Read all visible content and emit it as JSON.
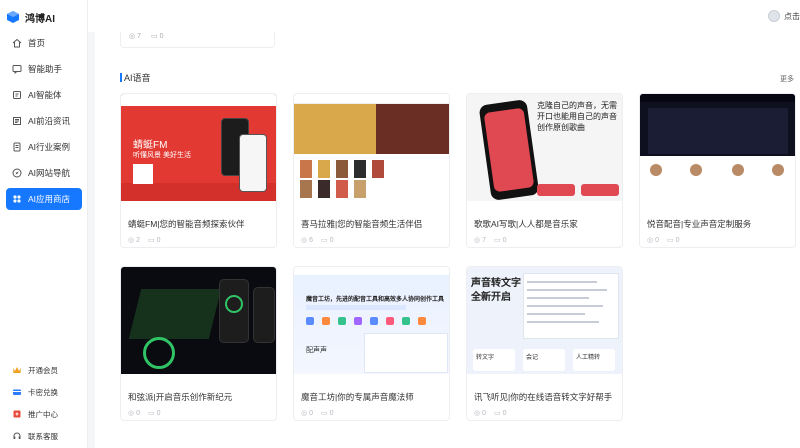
{
  "app": {
    "name": "鸿博AI"
  },
  "sidebar": {
    "items": [
      {
        "label": "首页",
        "icon": "home-icon"
      },
      {
        "label": "智能助手",
        "icon": "chat-icon"
      },
      {
        "label": "AI智能体",
        "icon": "agent-icon"
      },
      {
        "label": "AI前沿资讯",
        "icon": "news-icon"
      },
      {
        "label": "AI行业案例",
        "icon": "case-icon"
      },
      {
        "label": "AI网站导航",
        "icon": "compass-icon"
      },
      {
        "label": "AI应用商店",
        "icon": "apps-icon",
        "active": true
      }
    ],
    "bottom": [
      {
        "label": "开通会员",
        "icon": "vip-icon"
      },
      {
        "label": "卡密兑换",
        "icon": "card-icon"
      },
      {
        "label": "推广中心",
        "icon": "promo-icon"
      },
      {
        "label": "联系客服",
        "icon": "service-icon"
      }
    ]
  },
  "topbar": {
    "user_label": "点击"
  },
  "prev_card": {
    "views": "7",
    "comments": "0"
  },
  "section": {
    "title": "AI语音",
    "more": "更多"
  },
  "cards": [
    {
      "title": "蜻蜓FM|您的智能音频探索伙伴",
      "views": "2",
      "comments": "0",
      "thumb": {
        "t1": "蜻蜓FM",
        "t2": "听懂风景  美好生活"
      }
    },
    {
      "title": "喜马拉雅|您的智能音频生活伴侣",
      "views": "6",
      "comments": "0"
    },
    {
      "title": "歌歌AI写歌|人人都是音乐家",
      "views": "7",
      "comments": "0",
      "thumb": {
        "head": "克隆自己的声音，无需开口也能用自己的声音创作原创歌曲"
      }
    },
    {
      "title": "悦音配音|专业声音定制服务",
      "views": "0",
      "comments": "0"
    },
    {
      "title": "和弦派|开启音乐创作新纪元",
      "views": "0",
      "comments": "0"
    },
    {
      "title": "魔音工坊|你的专属声音魔法师",
      "views": "0",
      "comments": "0",
      "thumb": {
        "title": "魔音工坊，先进的配音工具和高效多人协同创作工具",
        "cap": "配声声"
      }
    },
    {
      "title": "讯飞听见|你的在线语音转文字好帮手",
      "views": "0",
      "comments": "0",
      "thumb": {
        "head": "声音转文字 全新开启",
        "tile1": "转文字",
        "tile2": "会记",
        "tile3": "人工精转"
      }
    }
  ]
}
